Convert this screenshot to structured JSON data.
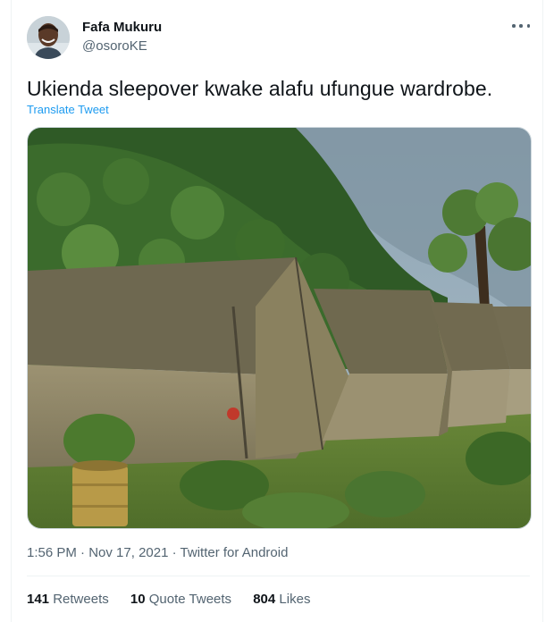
{
  "author": {
    "name": "Fafa Mukuru",
    "handle": "@osoroKE",
    "avatar_icon": "user-avatar"
  },
  "menu_icon": "more-horizontal-icon",
  "tweet": {
    "text": "Ukienda sleepover kwake alafu ufungue wardrobe.",
    "translate_label": "Translate Tweet",
    "media_icon": "photo-tents-in-forest",
    "time": "1:56 PM",
    "date": "Nov 17, 2021",
    "source": "Twitter for Android",
    "separator": "·"
  },
  "stats": {
    "retweets_count": "141",
    "retweets_label": "Retweets",
    "quotes_count": "10",
    "quotes_label": "Quote Tweets",
    "likes_count": "804",
    "likes_label": "Likes"
  },
  "colors": {
    "accent": "#1d9bf0",
    "text_primary": "#0f1419",
    "text_secondary": "#536471",
    "border": "#eff3f4"
  }
}
